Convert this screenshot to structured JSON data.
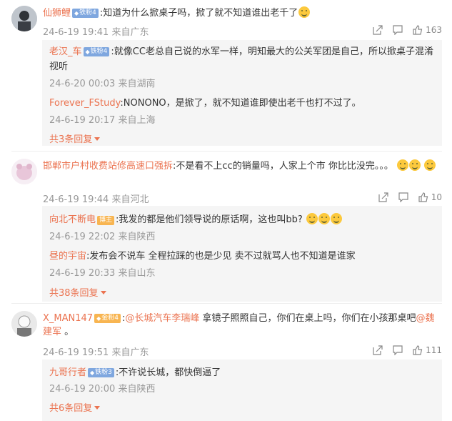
{
  "comments": [
    {
      "username": "仙狮鲤",
      "badge": "铁粉4",
      "text": ":知道为什么掀桌子吗，掀了就不知道谁出老千了",
      "time": "24-6-19 19:41 来自广东",
      "likes": "163",
      "replies": [
        {
          "username": "老汉_车",
          "badge": "铁粉4",
          "text": ":就像CC老总自己说的水军一样，明知最大的公关军团是自己，所以掀桌子混淆视听",
          "time": "24-6-20 00:03 来自湖南"
        },
        {
          "username": "Forever_FStudy",
          "text": ":NONONO，是掀了，就不知道谁即使出老千也打不过了。",
          "time": "24-6-19 20:17 来自上海"
        }
      ],
      "more": "共3条回复"
    },
    {
      "username": "邯郸市户村收费站修高速口强拆",
      "text": ":不是看不上cc的销量吗，人家上个市 你比比没完。。。",
      "time": "24-6-19 19:44 来自河北",
      "likes": "10",
      "replies": [
        {
          "username": "向北不断电",
          "badge": "博主",
          "text": ":我发的都是他们领导说的原话啊，这也叫bb?",
          "time": "24-6-19 22:02 来自陕西"
        },
        {
          "username": "昼的宇宙",
          "text": ":发布会不说车 全程拉踩的也是少见  卖不过就骂人也不知道是谁家",
          "time": "24-6-19 20:33 来自山东"
        }
      ],
      "more": "共38条回复"
    },
    {
      "username": "X_MAN147",
      "badge": "金粉4",
      "text_prefix": ":",
      "at1": "@长城汽车李瑞峰",
      "text_mid": " 拿镜子照照自己，你们在桌上吗，你们在小孩那桌吧",
      "at2": "@魏建军",
      "text_suffix": " 。",
      "time": "24-6-19 19:51 来自广东",
      "likes": "111",
      "replies": [
        {
          "username": "九哥行者",
          "badge": "铁粉3",
          "text": ":不许说长城，都快倒逼了",
          "time": "24-6-19 20:00 来自陕西"
        }
      ],
      "more": "共6条回复"
    }
  ],
  "colors": {
    "name": "#eb7350",
    "meta": "#999999",
    "reply_bg": "#f5f5f5"
  },
  "icons": [
    "share-icon",
    "comment-icon",
    "like-icon"
  ]
}
